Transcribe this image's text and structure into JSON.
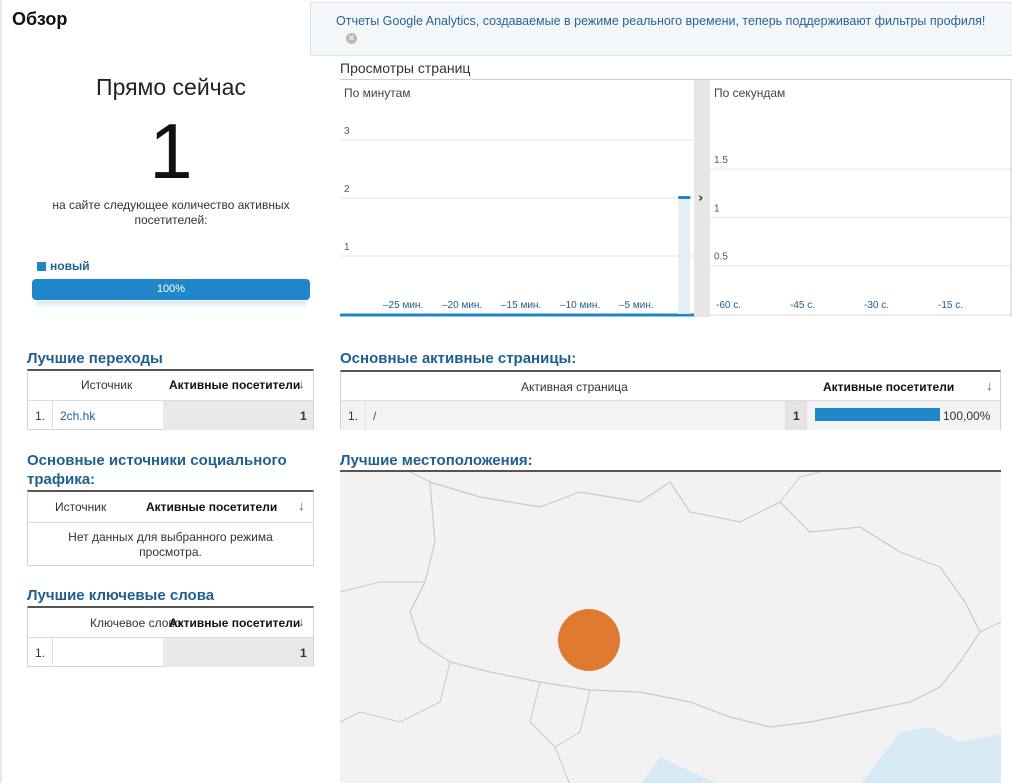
{
  "page": {
    "title": "Обзор"
  },
  "notice": {
    "text": "Отчеты Google Analytics, создаваемые в режиме реального времени, теперь поддерживают фильтры профиля!",
    "close_icon": "close-icon"
  },
  "right_now": {
    "title": "Прямо сейчас",
    "count": "1",
    "description": "на сайте следующее количество активных посетителей:",
    "legend_label": "новый",
    "legend_color": "#1f86c9",
    "bar_label": "100%",
    "bar_fraction": 1.0
  },
  "pageviews": {
    "title": "Просмотры страниц",
    "per_minute_label": "По минутам",
    "per_second_label": "По секундам",
    "expand_icon": "chevron-right-icon"
  },
  "chart_data": [
    {
      "type": "bar",
      "title": "По минутам",
      "y_ticks": [
        "1",
        "2",
        "3"
      ],
      "ylim": [
        0,
        3
      ],
      "x_tick_labels": [
        "–25 мин.",
        "–20 мин.",
        "–15 мин.",
        "–10 мин.",
        "–5 мин."
      ],
      "x_range": [
        -30,
        0
      ],
      "series": [
        {
          "values": [
            {
              "x": -1,
              "y": 2
            }
          ]
        }
      ],
      "color": "#1f86c9"
    },
    {
      "type": "bar",
      "title": "По секундам",
      "y_ticks": [
        "0.5",
        "1",
        "1.5"
      ],
      "ylim": [
        0,
        1.8
      ],
      "x_tick_labels": [
        "-60 с.",
        "-45 с.",
        "-30 с.",
        "-15 с."
      ],
      "x_range": [
        -60,
        0
      ],
      "series": [
        {
          "values": []
        }
      ],
      "color": "#1f86c9"
    }
  ],
  "top_referrals": {
    "title": "Лучшие переходы",
    "col_source": "Источник",
    "col_active": "Активные посетители",
    "rows": [
      {
        "index": "1.",
        "source": "2ch.hk",
        "active": "1"
      }
    ]
  },
  "social": {
    "title": "Основные источники социального трафика:",
    "col_source": "Источник",
    "col_active": "Активные посетители",
    "empty": "Нет данных для выбранного режима просмотра."
  },
  "keywords": {
    "title": "Лучшие ключевые слова",
    "col_keyword": "Ключевое слово",
    "col_active": "Активные посетители",
    "rows": [
      {
        "index": "1.",
        "keyword": "",
        "active": "1"
      }
    ]
  },
  "top_pages": {
    "title": "Основные активные страницы:",
    "col_page": "Активная страница",
    "col_active": "Активные посетители",
    "rows": [
      {
        "index": "1.",
        "page": "/",
        "active": "1",
        "percent": "100,00%",
        "fraction": 1.0
      }
    ]
  },
  "locations": {
    "title": "Лучшие местоположения:",
    "marker_color": "#e07a30",
    "land_color": "#f2f2f2",
    "water_color": "#eef6fb"
  }
}
